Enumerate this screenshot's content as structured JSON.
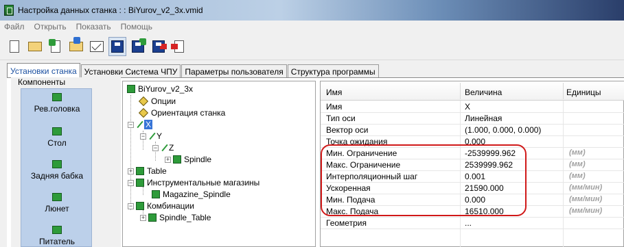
{
  "window": {
    "title": "Настройка данных станка : : BiYurov_v2_3x.vmid"
  },
  "menu": [
    "Файл",
    "Открыть",
    "Показать",
    "Помощь"
  ],
  "toolbar": {
    "icons": [
      "new-file-icon",
      "open-folder-icon",
      "import-icon",
      "download-icon",
      "mail-icon",
      "save-icon",
      "save-add-icon",
      "save-as-icon",
      "exit-icon"
    ]
  },
  "tabs": [
    "Установки станка",
    "Установки Система ЧПУ",
    "Параметры пользователя",
    "Структура программы"
  ],
  "components": {
    "header": "Компоненты",
    "items": [
      "Рев.головка",
      "Стол",
      "Задняя бабка",
      "Люнет",
      "Питатель"
    ]
  },
  "tree": {
    "root": "BiYurov_v2_3x",
    "options": "Опции",
    "orientation": "Ориентация станка",
    "x": "X",
    "y": "Y",
    "z": "Z",
    "spindle": "Spindle",
    "table": "Table",
    "tool_magazines": "Инструментальные магазины",
    "magazine_spindle": "Magazine_Spindle",
    "combinations": "Комбинации",
    "spindle_table": "Spindle_Table"
  },
  "grid": {
    "headers": {
      "name": "Имя",
      "value": "Величина",
      "units": "Единицы"
    },
    "rows": [
      {
        "name": "Имя",
        "value": "X",
        "unit": ""
      },
      {
        "name": "Тип оси",
        "value": "Линейная",
        "unit": ""
      },
      {
        "name": "Вектор оси",
        "value": "(1.000, 0.000, 0.000)",
        "unit": ""
      },
      {
        "name": "Точка ожидания",
        "value": "0.000",
        "unit": ""
      },
      {
        "name": "Мин. Ограничение",
        "value": "-2539999.962",
        "unit": "(мм)"
      },
      {
        "name": "Макс. Ограничение",
        "value": "2539999.962",
        "unit": "(мм)"
      },
      {
        "name": "Интерполяционный шаг",
        "value": "0.001",
        "unit": "(мм)"
      },
      {
        "name": "Ускоренная",
        "value": "21590.000",
        "unit": "(мм/мин)"
      },
      {
        "name": "Мин. Подача",
        "value": "0.000",
        "unit": "(мм/мин)"
      },
      {
        "name": "Макс. Подача",
        "value": "16510.000",
        "unit": "(мм/мин)"
      },
      {
        "name": "Геометрия",
        "value": "...",
        "unit": ""
      }
    ]
  },
  "colors": {
    "selection": "#3875d7",
    "highlight": "#d01818",
    "component_list": "#bcd0ea"
  }
}
